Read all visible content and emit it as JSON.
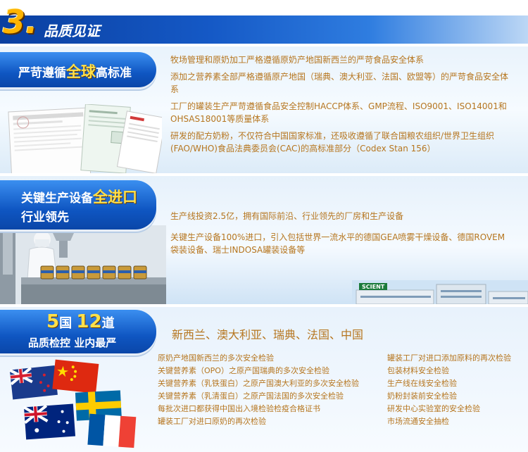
{
  "header": {
    "number": "3.",
    "title": "品质见证"
  },
  "section1": {
    "tag_prefix": "严苛遵循",
    "tag_highlight": "全球",
    "tag_suffix": "高标准",
    "paragraphs": [
      "牧场管理和原奶加工严格遵循原奶产地国新西兰的严苛食品安全体系",
      "添加之营养素全部严格遵循原产地国（瑞典、澳大利亚、法国、欧盟等）的严苛食品安全体系",
      "工厂的罐装生产严苛遵循食品安全控制HACCP体系、GMP流程、ISO9001、ISO14001和OHSAS18001等质量体系",
      "研发的配方奶粉，不仅符合中国国家标准，还吸收遵循了联合国粮农组织/世界卫生组织(FAO/WHO)食品法典委员会(CAC)的高标准部分（Codex Stan 156）"
    ]
  },
  "section2": {
    "tag_line1_prefix": "关键生产设备",
    "tag_line1_highlight": "全进口",
    "tag_line2": "行业领先",
    "paragraphs": [
      "生产线投资2.5亿，拥有国际前沿、行业领先的厂房和生产设备",
      "关键生产设备100%进口，引入包括世界一流水平的德国GEA喷雾干燥设备、德国ROVEM袋装设备、瑞士INDOSA罐装设备等"
    ],
    "factory_sign": "SCIENT"
  },
  "section3": {
    "tag_num1": "5",
    "tag_char1": "国",
    "tag_num2": "12",
    "tag_char2": "道",
    "tag_line2": "品质检控 业内最严",
    "countries": "新西兰、澳大利亚、瑞典、法国、中国",
    "list_left": [
      "原奶产地国新西兰的多次安全检验",
      "关键营养素（OPO）之原产国瑞典的多次安全检验",
      "关键营养素（乳铁蛋白）之原产国澳大利亚的多次安全检验",
      "关键营养素（乳清蛋白）之原产国法国的多次安全检验",
      "每批次进口都获得中国出入境检验检疫合格证书",
      "罐装工厂对进口原奶的再次检验"
    ],
    "list_right": [
      "罐装工厂对进口添加原料的再次检验",
      "包装材料安全检验",
      "生产线在线安全检验",
      "奶粉封装前安全检验",
      "研发中心实验室的安全检验",
      "市场流通安全抽检"
    ]
  },
  "colors": {
    "header_blue": "#1559c6",
    "text_gold": "#b6761f",
    "highlight_yellow": "#ffe04a"
  }
}
